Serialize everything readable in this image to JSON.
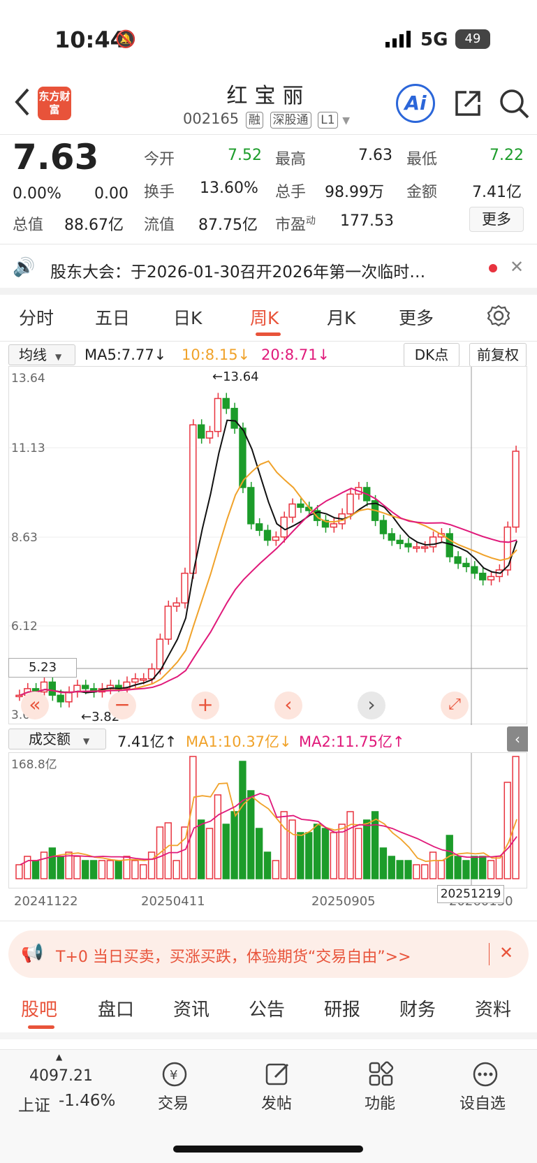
{
  "status": {
    "time": "10:44",
    "network": "5G",
    "battery": "49"
  },
  "header": {
    "title": "红宝丽",
    "code": "002165",
    "tags": [
      "融",
      "深股通",
      "L1"
    ],
    "logo": "东方财富",
    "ai": "Ai"
  },
  "quote": {
    "price": "7.63",
    "change_pct": "0.00%",
    "change": "0.00",
    "cells": [
      {
        "label": "今开",
        "value": "7.52",
        "color": "green"
      },
      {
        "label": "最高",
        "value": "7.63",
        "color": "black"
      },
      {
        "label": "最低",
        "value": "7.22",
        "color": "green"
      },
      {
        "label": "换手",
        "value": "13.60%",
        "color": "black"
      },
      {
        "label": "总手",
        "value": "98.99万",
        "color": "black"
      },
      {
        "label": "金额",
        "value": "7.41亿",
        "color": "black"
      },
      {
        "label": "总值",
        "value": "88.67亿",
        "color": "black"
      },
      {
        "label": "流值",
        "value": "87.75亿",
        "color": "black"
      },
      {
        "label": "市盈",
        "sup": "动",
        "value": "177.53",
        "color": "black"
      }
    ],
    "more": "更多"
  },
  "notice": "股东大会：于2026-01-30召开2026年第一次临时…",
  "period_tabs": [
    "分时",
    "五日",
    "日K",
    "周K",
    "月K",
    "更多"
  ],
  "active_tab": "周K",
  "chart": {
    "indicator": "均线",
    "ma5": "MA5:7.77↓",
    "ma10": "10:8.15↓",
    "ma20": "20:8.71↓",
    "dk": "DK点",
    "adjust": "前复权",
    "y_labels": [
      "13.64",
      "11.13",
      "8.63",
      "6.12",
      "3.62"
    ],
    "high_label": "←13.64",
    "low_label": "←3.82",
    "cross_label": "5.23"
  },
  "volume": {
    "indicator": "成交额",
    "value": "7.41亿↑",
    "ma1": "MA1:10.37亿↓",
    "ma2": "MA2:11.75亿↑",
    "y_max": "168.8亿",
    "dates": [
      "20241122",
      "20250411",
      "20250905",
      "20260130"
    ],
    "cursor_date": "20251219"
  },
  "chart_data": {
    "type": "candlestick",
    "y_range": [
      3.62,
      13.64
    ],
    "last_close": 7.63,
    "ma5": 7.77,
    "ma10": 8.15,
    "ma20": 8.71
  },
  "promo": "T+0 当日买卖，买涨买跌，体验期货“交易自由”>>",
  "bottom_tabs": [
    "股吧",
    "盘口",
    "资讯",
    "公告",
    "研报",
    "财务",
    "资料"
  ],
  "nav": {
    "index_value": "4097.21",
    "index_name": "上证",
    "index_change": "-1.46%",
    "items": [
      "交易",
      "发帖",
      "功能",
      "设自选"
    ]
  }
}
